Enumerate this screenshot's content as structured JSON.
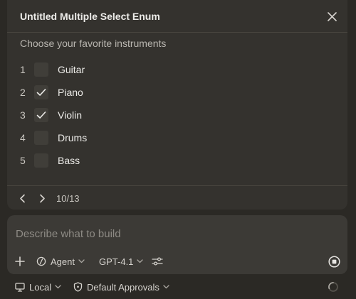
{
  "dialog": {
    "title": "Untitled Multiple Select Enum",
    "question": "Choose your favorite instruments",
    "options": [
      {
        "number": "1",
        "label": "Guitar",
        "checked": false
      },
      {
        "number": "2",
        "label": "Piano",
        "checked": true
      },
      {
        "number": "3",
        "label": "Violin",
        "checked": true
      },
      {
        "number": "4",
        "label": "Drums",
        "checked": false
      },
      {
        "number": "5",
        "label": "Bass",
        "checked": false
      }
    ],
    "pager": "10/13",
    "icons": {
      "close": "close-icon",
      "prev": "chevron-left-icon",
      "next": "chevron-right-icon"
    }
  },
  "composer": {
    "placeholder": "Describe what to build",
    "value": "",
    "agent_label": "Agent",
    "model_label": "GPT-4.1",
    "icons": {
      "add": "plus-icon",
      "agent": "agent-icon",
      "tune": "sliders-icon",
      "stop": "stop-icon"
    }
  },
  "statusbar": {
    "environment_label": "Local",
    "approvals_label": "Default Approvals",
    "icons": {
      "environment": "monitor-icon",
      "approvals": "shield-icon",
      "busy": "spinner-icon"
    }
  },
  "colors": {
    "background": "#2b2925",
    "panel": "#34322e",
    "composer": "#3c3a36",
    "text": "#ecebe8",
    "muted": "#8e8b85"
  }
}
